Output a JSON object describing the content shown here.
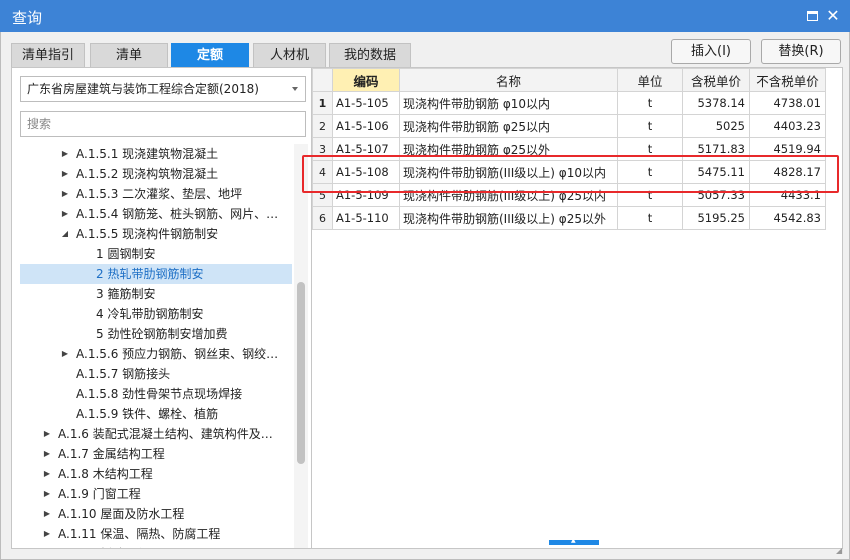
{
  "window": {
    "title": "查询"
  },
  "tabs": [
    {
      "label": "清单指引",
      "active": false
    },
    {
      "label": "清单",
      "active": false
    },
    {
      "label": "定额",
      "active": true
    },
    {
      "label": "人材机",
      "active": false
    },
    {
      "label": "我的数据",
      "active": false
    }
  ],
  "toolbar": {
    "insert_label": "插入(I)",
    "replace_label": "替换(R)"
  },
  "left": {
    "library": "广东省房屋建筑与装饰工程综合定额(2018)",
    "search_placeholder": "搜索"
  },
  "tree": [
    {
      "label": "A.1.5.1 现浇建筑物混凝土",
      "expander": "collapsed",
      "level": 3
    },
    {
      "label": "A.1.5.2 现浇构筑物混凝土",
      "expander": "collapsed",
      "level": 3
    },
    {
      "label": "A.1.5.3 二次灌浆、垫层、地坪",
      "expander": "collapsed",
      "level": 3
    },
    {
      "label": "A.1.5.4 钢筋笼、桩头钢筋、网片、…",
      "expander": "collapsed",
      "level": 3
    },
    {
      "label": "A.1.5.5 现浇构件钢筋制安",
      "expander": "expanded",
      "level": 3
    },
    {
      "label": "1 圆钢制安",
      "expander": "none",
      "level": 4
    },
    {
      "label": "2 热轧带肋钢筋制安",
      "expander": "none",
      "level": 4,
      "selected": true
    },
    {
      "label": "3 箍筋制安",
      "expander": "none",
      "level": 4
    },
    {
      "label": "4 冷轧带肋钢筋制安",
      "expander": "none",
      "level": 4
    },
    {
      "label": "5 劲性砼钢筋制安增加费",
      "expander": "none",
      "level": 4
    },
    {
      "label": "A.1.5.6 预应力钢筋、钢丝束、钢绞…",
      "expander": "collapsed",
      "level": 3
    },
    {
      "label": "A.1.5.7 钢筋接头",
      "expander": "none",
      "level": 3
    },
    {
      "label": "A.1.5.8 劲性骨架节点现场焊接",
      "expander": "none",
      "level": 3
    },
    {
      "label": "A.1.5.9 铁件、螺栓、植筋",
      "expander": "none",
      "level": 3
    },
    {
      "label": "A.1.6 装配式混凝土结构、建筑构件及…",
      "expander": "collapsed",
      "level": 2
    },
    {
      "label": "A.1.7 金属结构工程",
      "expander": "collapsed",
      "level": 2
    },
    {
      "label": "A.1.8 木结构工程",
      "expander": "collapsed",
      "level": 2
    },
    {
      "label": "A.1.9 门窗工程",
      "expander": "collapsed",
      "level": 2
    },
    {
      "label": "A.1.10 屋面及防水工程",
      "expander": "collapsed",
      "level": 2
    },
    {
      "label": "A.1.11 保温、隔热、防腐工程",
      "expander": "collapsed",
      "level": 2
    },
    {
      "label": "A.1.12 拆除工程",
      "expander": "collapsed",
      "level": 2
    }
  ],
  "table": {
    "headers": [
      "编码",
      "名称",
      "单位",
      "含税单价",
      "不含税单价"
    ],
    "rows": [
      {
        "num": "1",
        "code": "A1-5-105",
        "name": "现浇构件带肋钢筋 φ10以内",
        "unit": "t",
        "price_tax": "5378.14",
        "price_notax": "4738.01"
      },
      {
        "num": "2",
        "code": "A1-5-106",
        "name": "现浇构件带肋钢筋 φ25以内",
        "unit": "t",
        "price_tax": "5025",
        "price_notax": "4403.23"
      },
      {
        "num": "3",
        "code": "A1-5-107",
        "name": "现浇构件带肋钢筋 φ25以外",
        "unit": "t",
        "price_tax": "5171.83",
        "price_notax": "4519.94"
      },
      {
        "num": "4",
        "code": "A1-5-108",
        "name": "现浇构件带肋钢筋(III级以上) φ10以内",
        "unit": "t",
        "price_tax": "5475.11",
        "price_notax": "4828.17"
      },
      {
        "num": "5",
        "code": "A1-5-109",
        "name": "现浇构件带肋钢筋(III级以上) φ25以内",
        "unit": "t",
        "price_tax": "5057.33",
        "price_notax": "4433.1"
      },
      {
        "num": "6",
        "code": "A1-5-110",
        "name": "现浇构件带肋钢筋(III级以上) φ25以外",
        "unit": "t",
        "price_tax": "5195.25",
        "price_notax": "4542.83"
      }
    ]
  },
  "colors": {
    "titlebar": "#3d83d6",
    "active_tab": "#1e88e5",
    "selected_row": "#cfe4f7",
    "highlight_box": "#e8292b",
    "code_header": "#fff0b3"
  }
}
